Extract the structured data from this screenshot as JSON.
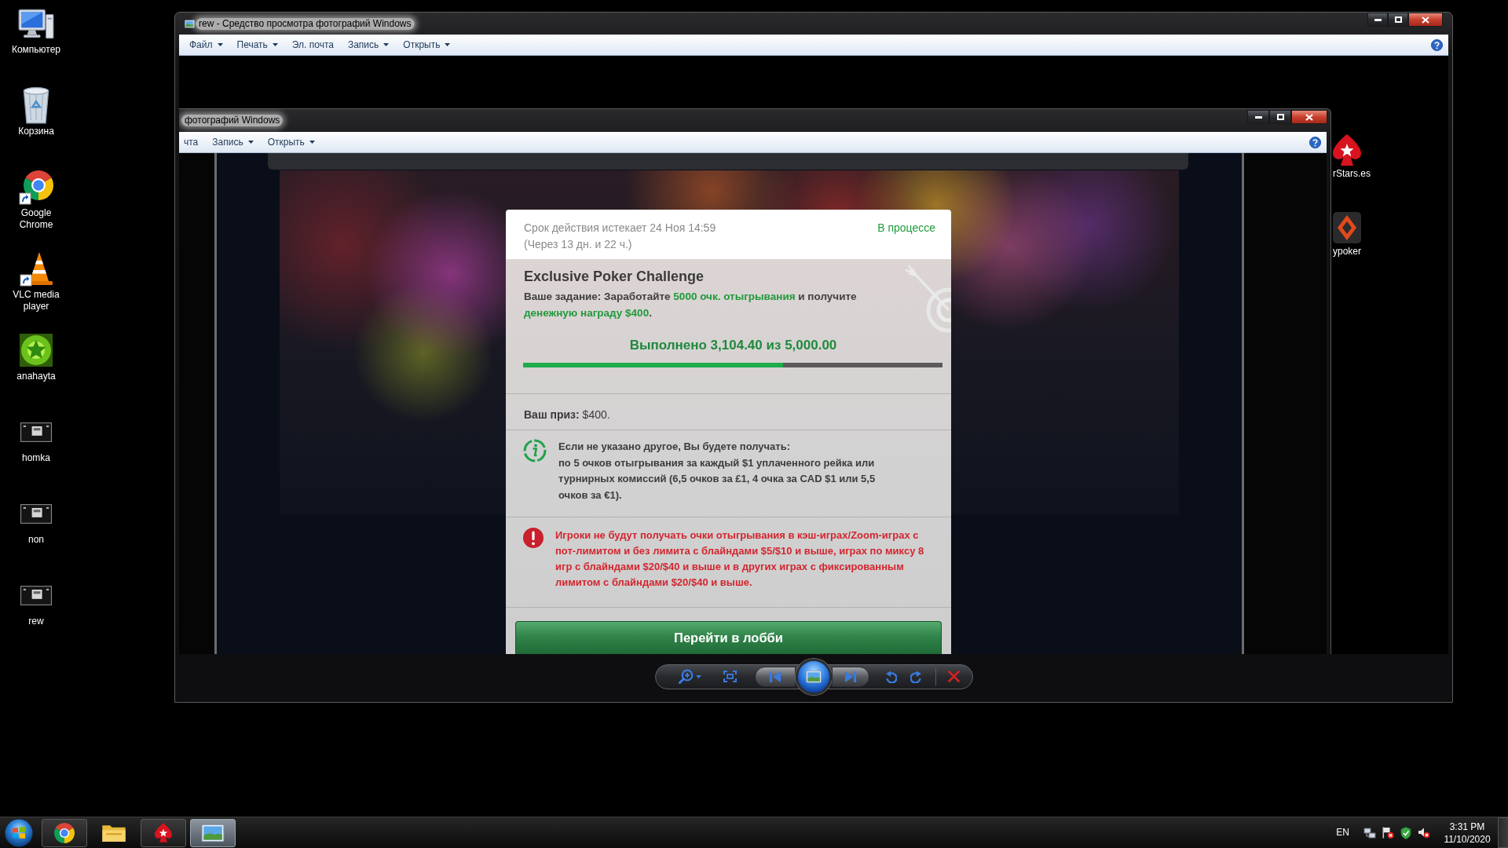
{
  "desktop_icons": [
    {
      "label": "Компьютер",
      "kind": "computer",
      "shortcut": false
    },
    {
      "label": "Корзина",
      "kind": "bin",
      "shortcut": false
    },
    {
      "label": "Google Chrome",
      "kind": "browser",
      "shortcut": true
    },
    {
      "label": "VLC media player",
      "kind": "cone",
      "shortcut": true
    },
    {
      "label": "anahayta",
      "kind": "star-image",
      "shortcut": false
    },
    {
      "label": "homka",
      "kind": "thumbnail",
      "shortcut": false
    },
    {
      "label": "non",
      "kind": "thumbnail",
      "shortcut": false
    },
    {
      "label": "rew",
      "kind": "thumbnail",
      "shortcut": false
    }
  ],
  "window": {
    "title": "rew - Средство просмотра фотографий Windows",
    "menu": [
      {
        "label": "Файл",
        "dropdown": true
      },
      {
        "label": "Печать",
        "dropdown": true
      },
      {
        "label": "Эл. почта",
        "dropdown": false
      },
      {
        "label": "Запись",
        "dropdown": true
      },
      {
        "label": "Открыть",
        "dropdown": true
      }
    ]
  },
  "image": {
    "window": {
      "title": "фотографий Windows",
      "menu": [
        {
          "label": "чта",
          "dropdown": false
        },
        {
          "label": "Запись",
          "dropdown": true
        },
        {
          "label": "Открыть",
          "dropdown": true
        }
      ]
    },
    "dialog": {
      "expiry": "Срок действия истекает 24 Ноя 14:59",
      "remaining": "(Через 13 дн. и 22 ч.)",
      "status": "В процессе",
      "title": "Exclusive Poker Challenge",
      "task": [
        {
          "text": "Ваше задание: Заработайте ",
          "highlight": false
        },
        {
          "text": "5000 очк. отыгрывания",
          "highlight": true
        },
        {
          "text": " и получите ",
          "highlight": false
        },
        {
          "text": "денежную награду $400",
          "highlight": true
        },
        {
          "text": ".",
          "highlight": false
        }
      ],
      "progress": {
        "label": "Выполнено 3,104.40 из 5,000.00",
        "level": 0.62
      },
      "prize": "**Ваш приз:** $400.",
      "notices": [
        {
          "kind": "info",
          "text": "Если не указано другое, Вы будете получать:\nпо 5 очков отыгрывания за каждый $1 уплаченного рейка или турнирных комиссий (6,5 очков за £1, 4 очка за CAD $1 или 5,5 очков за €1)."
        },
        {
          "kind": "warning",
          "text": "Игроки не будут получать очки отыгрывания в кэш-играх/Zoom-играх с пот-лимитом и без лимита с блайндами $5/$10 и выше, играх по миксу 8 игр с блайндами $20/$40 и выше и в других играх с фиксированным лимитом с блайндами $20/$40 и выше."
        }
      ],
      "button": "Перейти в лобби"
    },
    "desktop_icons": [
      {
        "label": "rStars.es",
        "kind": "spade"
      },
      {
        "label": "ypoker",
        "kind": "diamond"
      }
    ]
  },
  "taskbar": {
    "apps": [
      {
        "kind": "browser",
        "running": true,
        "selected": false
      },
      {
        "kind": "folder",
        "running": false,
        "selected": false
      },
      {
        "kind": "spade",
        "running": true,
        "selected": false
      },
      {
        "kind": "picture",
        "running": true,
        "selected": true
      }
    ],
    "language": "EN",
    "time": "3:31 PM",
    "date": "11/10/2020"
  }
}
